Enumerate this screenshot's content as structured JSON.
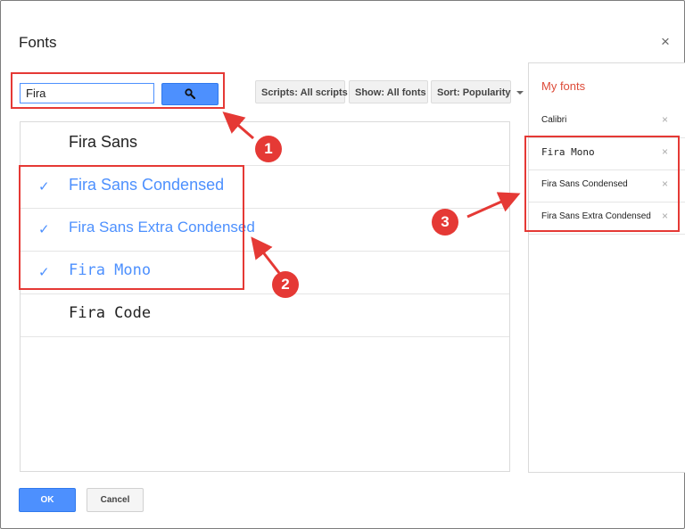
{
  "dialog": {
    "title": "Fonts",
    "close_glyph": "×"
  },
  "search": {
    "value": "Fira",
    "button_icon": "search-icon"
  },
  "filters": [
    {
      "label": "Scripts: All scripts"
    },
    {
      "label": "Show: All fonts"
    },
    {
      "label": "Sort: Popularity"
    }
  ],
  "font_list": [
    {
      "label": "Fira Sans",
      "selected": false,
      "check": ""
    },
    {
      "label": "Fira Sans Condensed",
      "selected": true,
      "check": "✓"
    },
    {
      "label": "Fira Sans Extra Condensed",
      "selected": true,
      "check": "✓"
    },
    {
      "label": "Fira Mono",
      "selected": true,
      "check": "✓"
    },
    {
      "label": "Fira Code",
      "selected": false,
      "check": ""
    }
  ],
  "my_fonts": {
    "title": "My fonts",
    "items": [
      {
        "label": "Calibri",
        "remove": "×"
      },
      {
        "label": "Fira Mono",
        "remove": "×"
      },
      {
        "label": "Fira Sans Condensed",
        "remove": "×"
      },
      {
        "label": "Fira Sans Extra Condensed",
        "remove": "×"
      }
    ]
  },
  "footer": {
    "ok_label": "OK",
    "cancel_label": "Cancel"
  },
  "annotations": {
    "color": "#e53935",
    "callouts": [
      "1",
      "2",
      "3"
    ]
  },
  "colors": {
    "accent": "#4d90fe",
    "my_fonts_title": "#dd4b39"
  }
}
